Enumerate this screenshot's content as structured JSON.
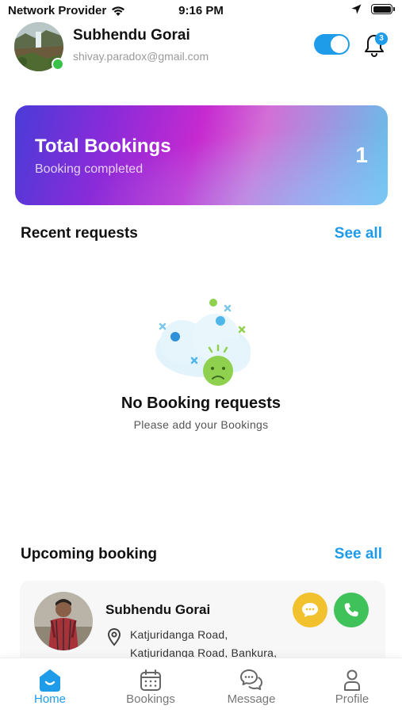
{
  "status_bar": {
    "carrier": "Network Provider",
    "time": "9:16 PM"
  },
  "header": {
    "name": "Subhendu Gorai",
    "email": "shivay.paradox@gmail.com",
    "notification_count": "3",
    "online_toggle_on": true
  },
  "summary_card": {
    "title": "Total Bookings",
    "subtitle": "Booking completed",
    "count": "1"
  },
  "recent_requests": {
    "title": "Recent requests",
    "see_all": "See all",
    "empty_title": "No Booking requests",
    "empty_subtitle": "Please add your Bookings"
  },
  "upcoming_booking": {
    "title": "Upcoming booking",
    "see_all": "See all",
    "item": {
      "name": "Subhendu Gorai",
      "address_line1": "Katjuridanga Road,",
      "address_line2": "Katjuridanga Road, Bankura,"
    }
  },
  "tabs": [
    {
      "label": "Home",
      "icon": "home-icon",
      "active": true
    },
    {
      "label": "Bookings",
      "icon": "calendar-icon",
      "active": false
    },
    {
      "label": "Message",
      "icon": "chat-icon",
      "active": false
    },
    {
      "label": "Profile",
      "icon": "user-icon",
      "active": false
    }
  ],
  "colors": {
    "accent": "#1e9be9",
    "online": "#39c24a",
    "chat_button": "#f2c12e",
    "call_button": "#3fc25a"
  }
}
